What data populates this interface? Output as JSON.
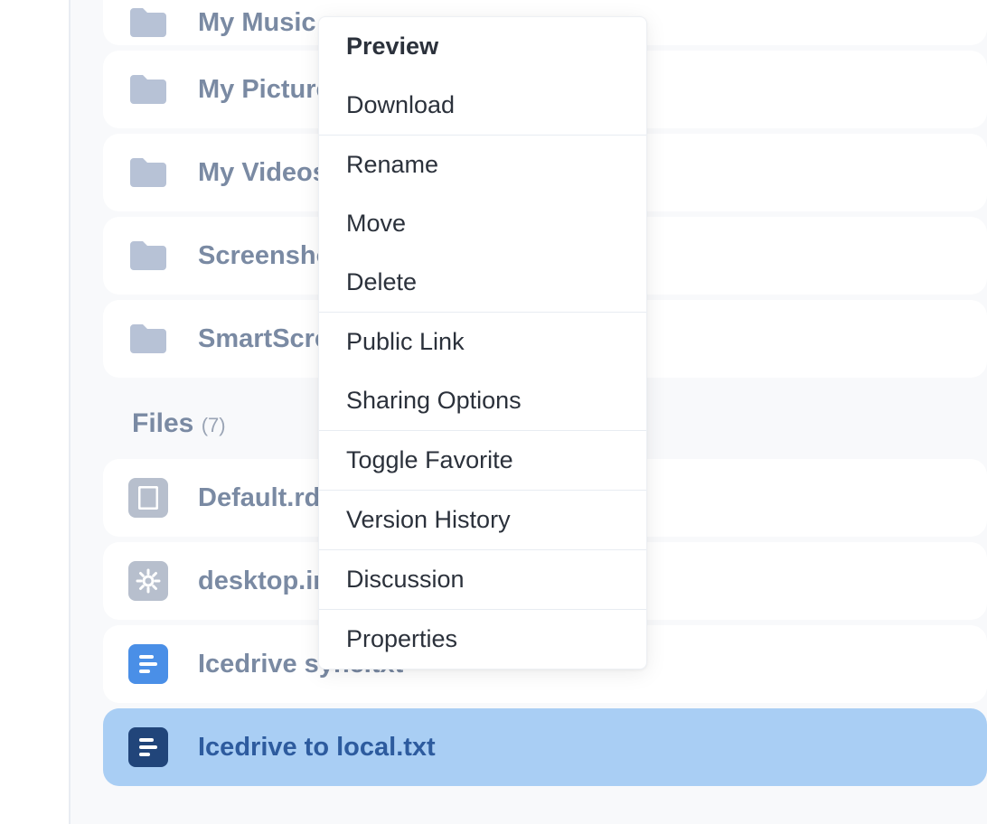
{
  "folders": [
    {
      "name": "My Music"
    },
    {
      "name": "My Pictures"
    },
    {
      "name": "My Videos"
    },
    {
      "name": "Screenshots"
    },
    {
      "name": "SmartScreen"
    }
  ],
  "files_header": {
    "label": "Files",
    "count": "(7)"
  },
  "files": [
    {
      "name": "Default.rdp",
      "icon": "page-gray"
    },
    {
      "name": "desktop.ini",
      "icon": "gear-gray"
    },
    {
      "name": "Icedrive sync.txt",
      "icon": "doc-blue"
    },
    {
      "name": "Icedrive to local.txt",
      "icon": "doc-darkblue",
      "selected": true
    }
  ],
  "context_menu": {
    "sections": [
      {
        "items": [
          {
            "label": "Preview",
            "bold": true
          },
          {
            "label": "Download"
          }
        ]
      },
      {
        "items": [
          {
            "label": "Rename"
          },
          {
            "label": "Move"
          },
          {
            "label": "Delete"
          }
        ]
      },
      {
        "items": [
          {
            "label": "Public Link"
          },
          {
            "label": "Sharing Options"
          }
        ]
      },
      {
        "items": [
          {
            "label": "Toggle Favorite"
          }
        ]
      },
      {
        "items": [
          {
            "label": "Version History"
          }
        ]
      },
      {
        "items": [
          {
            "label": "Discussion"
          }
        ]
      },
      {
        "items": [
          {
            "label": "Properties"
          }
        ]
      }
    ]
  }
}
